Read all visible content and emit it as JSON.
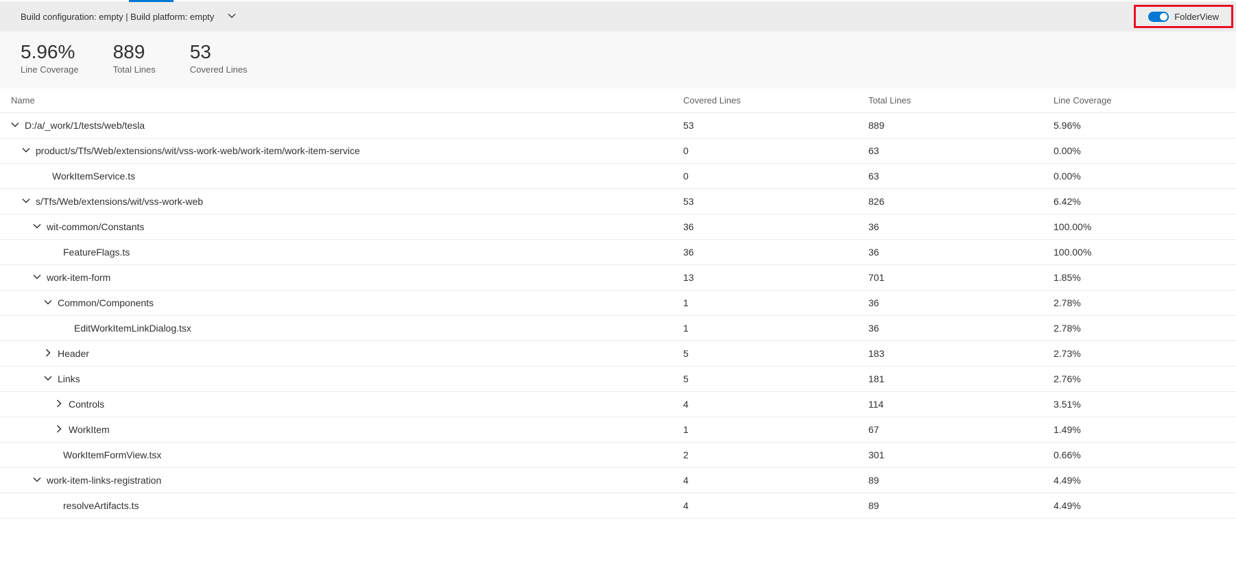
{
  "topbar": {
    "config_text": "Build configuration: empty | Build platform: empty",
    "toggle_label": "FolderView",
    "toggle_on": true
  },
  "summary": [
    {
      "value": "5.96%",
      "label": "Line Coverage"
    },
    {
      "value": "889",
      "label": "Total Lines"
    },
    {
      "value": "53",
      "label": "Covered Lines"
    }
  ],
  "columns": {
    "name": "Name",
    "covered": "Covered Lines",
    "total": "Total Lines",
    "coverage": "Line Coverage"
  },
  "rows": [
    {
      "indent": 0,
      "expander": "down",
      "name": "D:/a/_work/1/tests/web/tesla",
      "covered": "53",
      "total": "889",
      "coverage": "5.96%"
    },
    {
      "indent": 1,
      "expander": "down",
      "name": "product/s/Tfs/Web/extensions/wit/vss-work-web/work-item/work-item-service",
      "covered": "0",
      "total": "63",
      "coverage": "0.00%"
    },
    {
      "indent": 2,
      "expander": "none",
      "name": "WorkItemService.ts",
      "covered": "0",
      "total": "63",
      "coverage": "0.00%"
    },
    {
      "indent": 1,
      "expander": "down",
      "name": "s/Tfs/Web/extensions/wit/vss-work-web",
      "covered": "53",
      "total": "826",
      "coverage": "6.42%"
    },
    {
      "indent": 2,
      "expander": "down",
      "name": "wit-common/Constants",
      "covered": "36",
      "total": "36",
      "coverage": "100.00%"
    },
    {
      "indent": 3,
      "expander": "none",
      "name": "FeatureFlags.ts",
      "covered": "36",
      "total": "36",
      "coverage": "100.00%"
    },
    {
      "indent": 2,
      "expander": "down",
      "name": "work-item-form",
      "covered": "13",
      "total": "701",
      "coverage": "1.85%"
    },
    {
      "indent": 3,
      "expander": "down",
      "name": "Common/Components",
      "covered": "1",
      "total": "36",
      "coverage": "2.78%"
    },
    {
      "indent": 4,
      "expander": "none",
      "name": "EditWorkItemLinkDialog.tsx",
      "covered": "1",
      "total": "36",
      "coverage": "2.78%"
    },
    {
      "indent": 3,
      "expander": "right",
      "name": "Header",
      "covered": "5",
      "total": "183",
      "coverage": "2.73%"
    },
    {
      "indent": 3,
      "expander": "down",
      "name": "Links",
      "covered": "5",
      "total": "181",
      "coverage": "2.76%"
    },
    {
      "indent": 4,
      "expander": "right",
      "name": "Controls",
      "covered": "4",
      "total": "114",
      "coverage": "3.51%"
    },
    {
      "indent": 4,
      "expander": "right",
      "name": "WorkItem",
      "covered": "1",
      "total": "67",
      "coverage": "1.49%"
    },
    {
      "indent": 3,
      "expander": "none",
      "name": "WorkItemFormView.tsx",
      "covered": "2",
      "total": "301",
      "coverage": "0.66%"
    },
    {
      "indent": 2,
      "expander": "down",
      "name": "work-item-links-registration",
      "covered": "4",
      "total": "89",
      "coverage": "4.49%"
    },
    {
      "indent": 3,
      "expander": "none",
      "name": "resolveArtifacts.ts",
      "covered": "4",
      "total": "89",
      "coverage": "4.49%"
    }
  ]
}
